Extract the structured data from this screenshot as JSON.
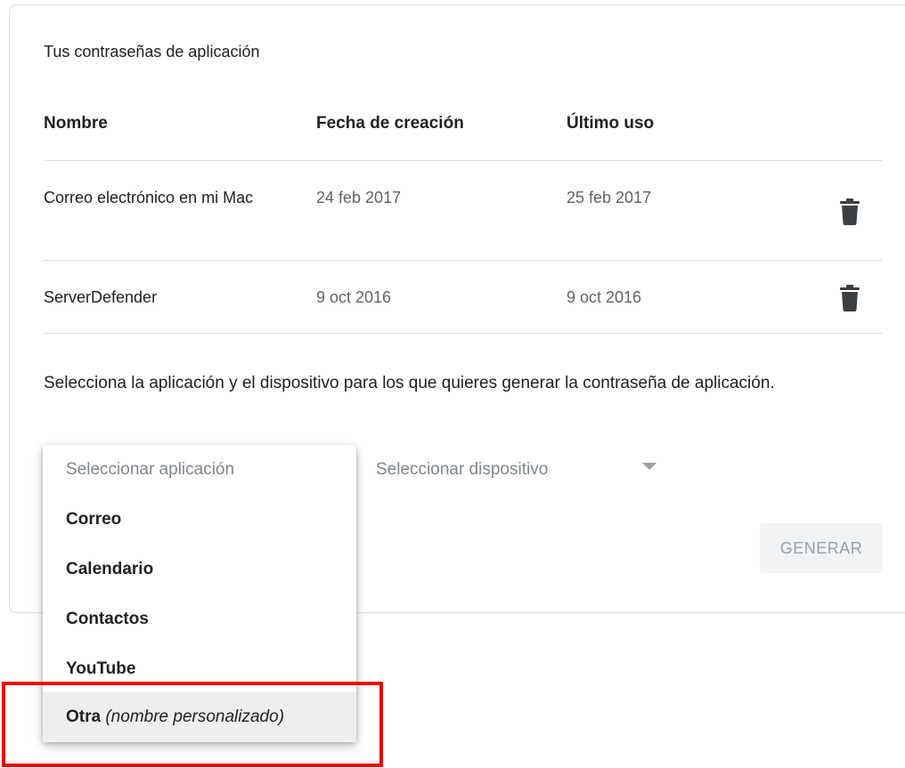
{
  "section_title": "Tus contraseñas de aplicación",
  "table": {
    "columns": [
      "Nombre",
      "Fecha de creación",
      "Último uso"
    ],
    "rows": [
      {
        "name": "Correo electrónico en mi Mac",
        "created": "24 feb 2017",
        "last_used": "25 feb 2017",
        "action_icon": "trash-icon"
      },
      {
        "name": "ServerDefender",
        "created": "9 oct 2016",
        "last_used": "9 oct 2016",
        "action_icon": "trash-icon"
      }
    ]
  },
  "instruction": "Selecciona la aplicación y el dispositivo para los que quieres generar la contraseña de aplicación.",
  "app_select": {
    "placeholder": "Seleccionar aplicación",
    "options": [
      "Correo",
      "Calendario",
      "Contactos",
      "YouTube"
    ],
    "custom_option": {
      "label": "Otra",
      "hint": "(nombre personalizado)"
    }
  },
  "device_select": {
    "placeholder": "Seleccionar dispositivo",
    "icon": "dropdown-arrow-icon"
  },
  "generate_button": "GENERAR",
  "colors": {
    "highlight_border": "#e80000",
    "divider": "#dadce0",
    "disabled_button_bg": "#f1f3f4"
  }
}
